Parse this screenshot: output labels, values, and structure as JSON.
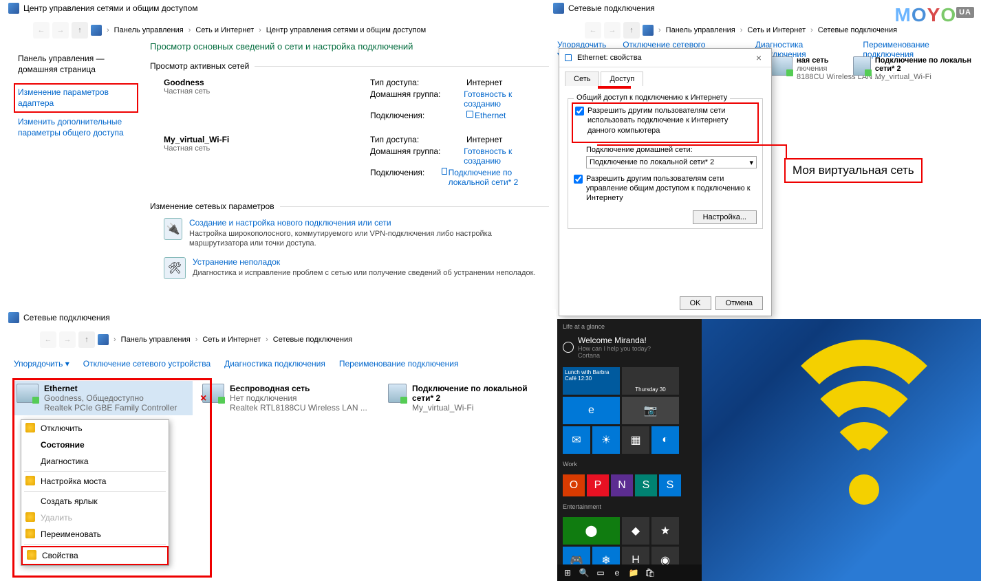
{
  "panelA": {
    "title": "Центр управления сетями и общим доступом",
    "breadcrumb": [
      "Панель управления",
      "Сеть и Интернет",
      "Центр управления сетями и общим доступом"
    ],
    "sidebar": {
      "home": "Панель управления — домашняя страница",
      "adapter": "Изменение параметров адаптера",
      "sharing": "Изменить дополнительные параметры общего доступа"
    },
    "heading": "Просмотр основных сведений о сети и настройка подключений",
    "activeHead": "Просмотр активных сетей",
    "net1": {
      "name": "Goodness",
      "type": "Частная сеть",
      "accessLbl": "Тип доступа:",
      "accessVal": "Интернет",
      "homeLbl": "Домашняя группа:",
      "homeVal": "Готовность к созданию",
      "connLbl": "Подключения:",
      "connVal": "Ethernet"
    },
    "net2": {
      "name": "My_virtual_Wi-Fi",
      "type": "Частная сеть",
      "accessLbl": "Тип доступа:",
      "accessVal": "Интернет",
      "homeLbl": "Домашняя группа:",
      "homeVal": "Готовность к созданию",
      "connLbl": "Подключения:",
      "connVal": "Подключение по локальной сети* 2"
    },
    "changeHead": "Изменение сетевых параметров",
    "task1": {
      "link": "Создание и настройка нового подключения или сети",
      "desc": "Настройка широкополосного, коммутируемого или VPN-подключения либо настройка маршрутизатора или точки доступа."
    },
    "task2": {
      "link": "Устранение неполадок",
      "desc": "Диагностика и исправление проблем с сетью или получение сведений об устранении неполадок."
    }
  },
  "panelB": {
    "title": "Сетевые подключения",
    "breadcrumb": [
      "Панель управления",
      "Сеть и Интернет",
      "Сетевые подключения"
    ],
    "toolbar": [
      "Упорядочить ▾",
      "Отключение сетевого устройства",
      "Диагностика подключения",
      "Переименование подключения"
    ],
    "conn1": {
      "name": "ная сеть",
      "sub1": "лючения",
      "sub2": "8188CU Wireless LAN ..."
    },
    "conn2": {
      "name": "Подключение по локальн сети* 2",
      "sub": "My_virtual_Wi-Fi"
    }
  },
  "dialog": {
    "title": "Ethernet: свойства",
    "tabs": [
      "Сеть",
      "Доступ"
    ],
    "groupTitle": "Общий доступ к подключению к Интернету",
    "chk1": "Разрешить другим пользователям сети использовать подключение к Интернету данного компьютера",
    "selLabel": "Подключение домашней сети:",
    "selValue": "Подключение по локальной сети* 2",
    "chk2": "Разрешить другим пользователям сети управление общим доступом к подключению к Интернету",
    "settings": "Настройка...",
    "ok": "OK",
    "cancel": "Отмена"
  },
  "annotation": "Моя виртуальная сеть",
  "panelC": {
    "title": "Сетевые подключения",
    "breadcrumb": [
      "Панель управления",
      "Сеть и Интернет",
      "Сетевые подключения"
    ],
    "toolbar": [
      "Упорядочить ▾",
      "Отключение сетевого устройства",
      "Диагностика подключения",
      "Переименование подключения"
    ],
    "c1": {
      "name": "Ethernet",
      "sub1": "Goodness, Общедоступно",
      "sub2": "Realtek PCIe GBE Family Controller"
    },
    "c2": {
      "name": "Беспроводная сеть",
      "sub1": "Нет подключения",
      "sub2": "Realtek RTL8188CU Wireless LAN ..."
    },
    "c3": {
      "name": "Подключение по локальной сети* 2",
      "sub1": "My_virtual_Wi-Fi",
      "sub2": ""
    },
    "ctx": [
      "Отключить",
      "Состояние",
      "Диагностика",
      "Настройка моста",
      "Создать ярлык",
      "Удалить",
      "Переименовать",
      "Свойства"
    ]
  },
  "panelD": {
    "glance": "Life at a glance",
    "welcome": "Welcome Miranda!",
    "help": "How can I help you today?",
    "cortana": "Cortana",
    "lunch": "Lunch with Barbra Café 12:30",
    "thursday": "Thursday 30",
    "edge": "Microsoft Edge",
    "work": "Work",
    "entertainment": "Entertainment",
    "xbox": "Xbox"
  }
}
